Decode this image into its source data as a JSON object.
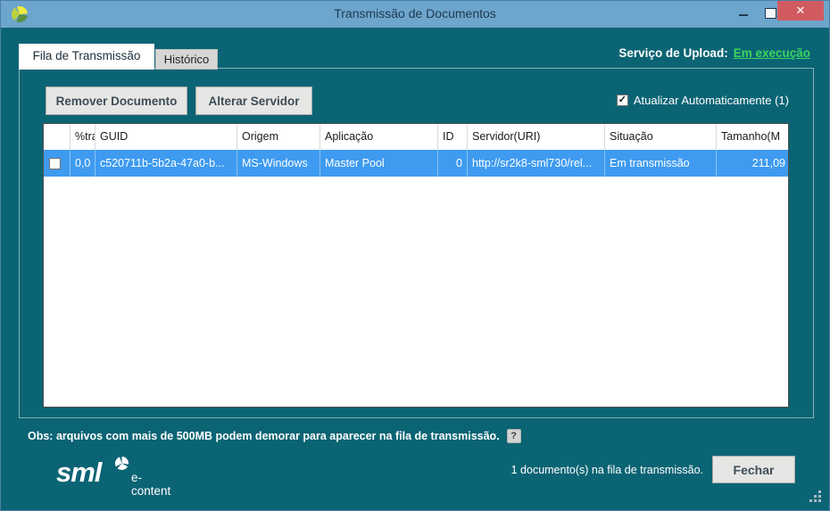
{
  "window": {
    "title": "Transmissão de Documentos",
    "close_glyph": "✕"
  },
  "tabs": {
    "queue": "Fila de Transmissão",
    "history": "Histórico"
  },
  "upload_service": {
    "label": "Serviço de Upload:",
    "status": "Em execução"
  },
  "toolbar": {
    "remove_document": "Remover Documento",
    "change_server": "Alterar Servidor",
    "auto_refresh": "Atualizar Automaticamente (1)",
    "auto_refresh_checked": true,
    "check_glyph": "✓"
  },
  "table": {
    "columns": [
      "",
      "%tra",
      "GUID",
      "Origem",
      "Aplicação",
      "ID",
      "Servidor(URI)",
      "Situação",
      "Tamanho(M"
    ],
    "rows": [
      {
        "selected": true,
        "checked": false,
        "cells": [
          "0,0",
          "c520711b-5b2a-47a0-b...",
          "MS-Windows",
          "Master Pool",
          "0",
          "http://sr2k8-sml730/rel...",
          "Em transmissão",
          "211,09"
        ]
      }
    ]
  },
  "note": {
    "text": "Obs: arquivos com mais de 500MB podem demorar para aparecer na fila de transmissão.",
    "help_glyph": "?"
  },
  "footer": {
    "logo": "sml",
    "logo_suffix": "e-content",
    "status": "1 documento(s) na fila de transmissão.",
    "close_button": "Fechar"
  },
  "colors": {
    "titlebar_blue": "#6da5cc",
    "content_teal": "#0b6474",
    "selected_row_blue": "#3e9bf0",
    "status_green": "#3bd65f",
    "close_button_red": "#d15b60"
  }
}
